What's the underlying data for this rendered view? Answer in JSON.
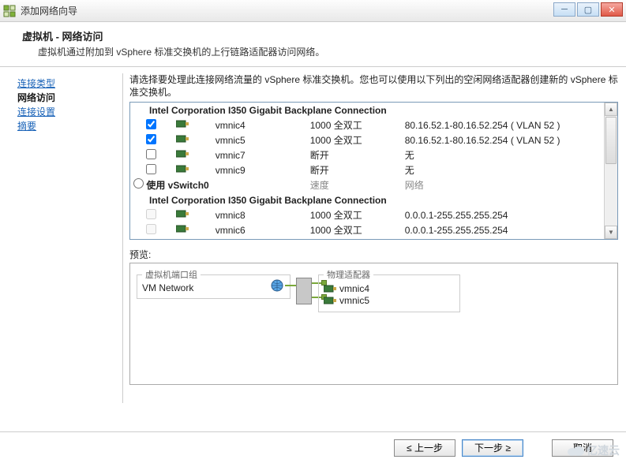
{
  "window": {
    "title": "添加网络向导",
    "min_tip": "最小化",
    "max_tip": "最大化",
    "close_tip": "关闭"
  },
  "header": {
    "title": "虚拟机 - 网络访问",
    "subtitle": "虚拟机通过附加到 vSphere 标准交换机的上行链路适配器访问网络。"
  },
  "sidebar": {
    "items": [
      {
        "label": "连接类型",
        "active": false
      },
      {
        "label": "网络访问",
        "active": true
      },
      {
        "label": "连接设置",
        "active": false
      },
      {
        "label": "摘要",
        "active": false
      }
    ]
  },
  "main": {
    "instruction": "请选择要处理此连接网络流量的 vSphere 标准交换机。您也可以使用以下列出的空闲网络适配器创建新的 vSphere 标准交换机。",
    "group1": {
      "title": "Intel Corporation I350 Gigabit Backplane Connection",
      "rows": [
        {
          "checked": true,
          "name": "vmnic4",
          "speed": "1000 全双工",
          "net": "80.16.52.1-80.16.52.254 ( VLAN 52 )"
        },
        {
          "checked": true,
          "name": "vmnic5",
          "speed": "1000 全双工",
          "net": "80.16.52.1-80.16.52.254 ( VLAN 52 )"
        },
        {
          "checked": false,
          "name": "vmnic7",
          "speed": "断开",
          "net": "无"
        },
        {
          "checked": false,
          "name": "vmnic9",
          "speed": "断开",
          "net": "无"
        }
      ]
    },
    "switch_row": {
      "selected": false,
      "label": "使用 vSwitch0",
      "speed_hdr": "速度",
      "net_hdr": "网络"
    },
    "group2": {
      "title": "Intel Corporation I350 Gigabit Backplane Connection",
      "rows": [
        {
          "checked": false,
          "name": "vmnic8",
          "speed": "1000 全双工",
          "net": "0.0.0.1-255.255.255.254"
        },
        {
          "checked": false,
          "name": "vmnic6",
          "speed": "1000 全双工",
          "net": "0.0.0.1-255.255.255.254"
        }
      ]
    }
  },
  "preview": {
    "label": "预览:",
    "portgroup_legend": "虚拟机端口组",
    "portgroup_name": "VM Network",
    "adapters_legend": "物理适配器",
    "adapters": [
      {
        "name": "vmnic4"
      },
      {
        "name": "vmnic5"
      }
    ]
  },
  "footer": {
    "back": "≤ 上一步",
    "next": "下一步 ≥",
    "cancel": "取消"
  },
  "watermark": "亿速云"
}
